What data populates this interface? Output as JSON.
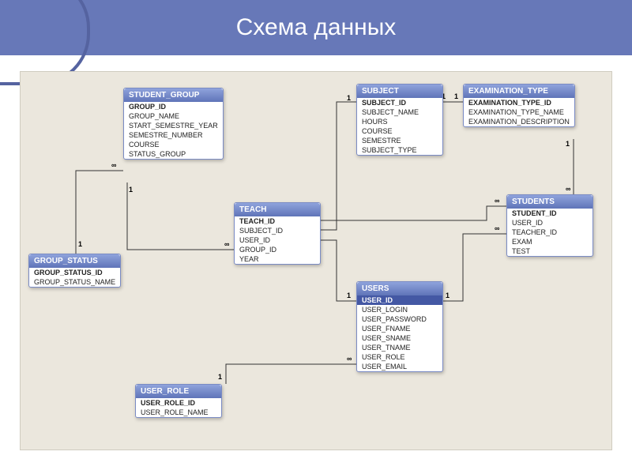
{
  "title": "Схема данных",
  "tables": {
    "student_group": {
      "name": "STUDENT_GROUP",
      "fields": [
        "GROUP_ID",
        "GROUP_NAME",
        "START_SEMESTRE_YEAR",
        "SEMESTRE_NUMBER",
        "COURSE",
        "STATUS_GROUP"
      ],
      "pk": "GROUP_ID"
    },
    "subject": {
      "name": "SUBJECT",
      "fields": [
        "SUBJECT_ID",
        "SUBJECT_NAME",
        "HOURS",
        "COURSE",
        "SEMESTRE",
        "SUBJECT_TYPE"
      ],
      "pk": "SUBJECT_ID"
    },
    "examination_type": {
      "name": "EXAMINATION_TYPE",
      "fields": [
        "EXAMINATION_TYPE_ID",
        "EXAMINATION_TYPE_NAME",
        "EXAMINATION_DESCRIPTION"
      ],
      "pk": "EXAMINATION_TYPE_ID"
    },
    "group_status": {
      "name": "GROUP_STATUS",
      "fields": [
        "GROUP_STATUS_ID",
        "GROUP_STATUS_NAME"
      ],
      "pk": "GROUP_STATUS_ID"
    },
    "teach": {
      "name": "TEACH",
      "fields": [
        "TEACH_ID",
        "SUBJECT_ID",
        "USER_ID",
        "GROUP_ID",
        "YEAR"
      ],
      "pk": "TEACH_ID"
    },
    "students": {
      "name": "STUDENTS",
      "fields": [
        "STUDENT_ID",
        "USER_ID",
        "TEACHER_ID",
        "EXAM",
        "TEST"
      ],
      "pk": "STUDENT_ID"
    },
    "user_role": {
      "name": "USER_ROLE",
      "fields": [
        "USER_ROLE_ID",
        "USER_ROLE_NAME"
      ],
      "pk": "USER_ROLE_ID"
    },
    "users": {
      "name": "USERS",
      "fields": [
        "USER_ID",
        "USER_LOGIN",
        "USER_PASSWORD",
        "USER_FNAME",
        "USER_SNAME",
        "USER_TNAME",
        "USER_ROLE",
        "USER_EMAIL"
      ],
      "pk": "USER_ID",
      "selected": "USER_ID"
    }
  },
  "cardinality": {
    "one": "1",
    "many": "∞"
  }
}
